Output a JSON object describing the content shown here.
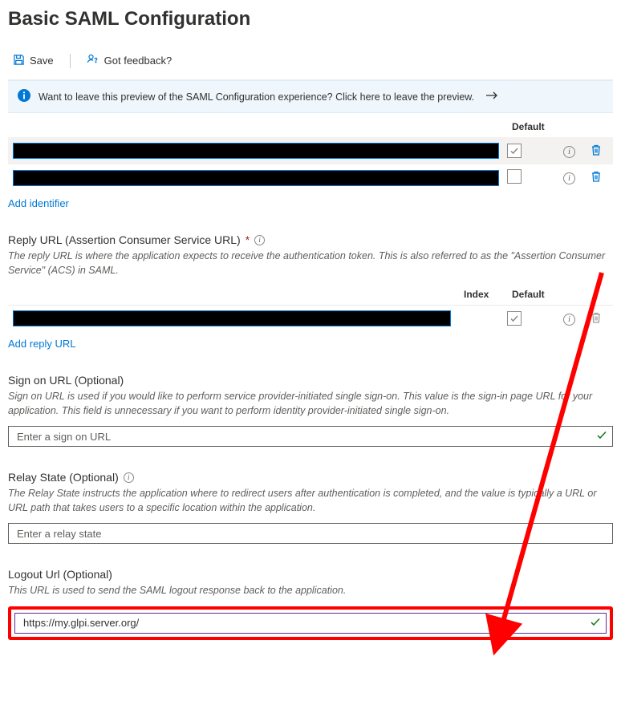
{
  "header": {
    "title": "Basic SAML Configuration"
  },
  "toolbar": {
    "save_label": "Save",
    "feedback_label": "Got feedback?"
  },
  "banner": {
    "text": "Want to leave this preview of the SAML Configuration experience? Click here to leave the preview."
  },
  "identifier_table": {
    "columns": {
      "default": "Default"
    },
    "rows": [
      {
        "default_checked": true
      },
      {
        "default_checked": false
      }
    ],
    "add_link": "Add identifier"
  },
  "reply_url": {
    "label": "Reply URL (Assertion Consumer Service URL)",
    "help": "The reply URL is where the application expects to receive the authentication token. This is also referred to as the \"Assertion Consumer Service\" (ACS) in SAML.",
    "columns": {
      "index": "Index",
      "default": "Default"
    },
    "rows": [
      {
        "default_checked": true
      }
    ],
    "add_link": "Add reply URL"
  },
  "sign_on_url": {
    "label": "Sign on URL (Optional)",
    "help": "Sign on URL is used if you would like to perform service provider-initiated single sign-on. This value is the sign-in page URL for your application. This field is unnecessary if you want to perform identity provider-initiated single sign-on.",
    "placeholder": "Enter a sign on URL",
    "value": ""
  },
  "relay_state": {
    "label": "Relay State (Optional)",
    "help": "The Relay State instructs the application where to redirect users after authentication is completed, and the value is typically a URL or URL path that takes users to a specific location within the application.",
    "placeholder": "Enter a relay state",
    "value": ""
  },
  "logout_url": {
    "label": "Logout Url (Optional)",
    "help": "This URL is used to send the SAML logout response back to the application.",
    "value": "https://my.glpi.server.org/"
  }
}
